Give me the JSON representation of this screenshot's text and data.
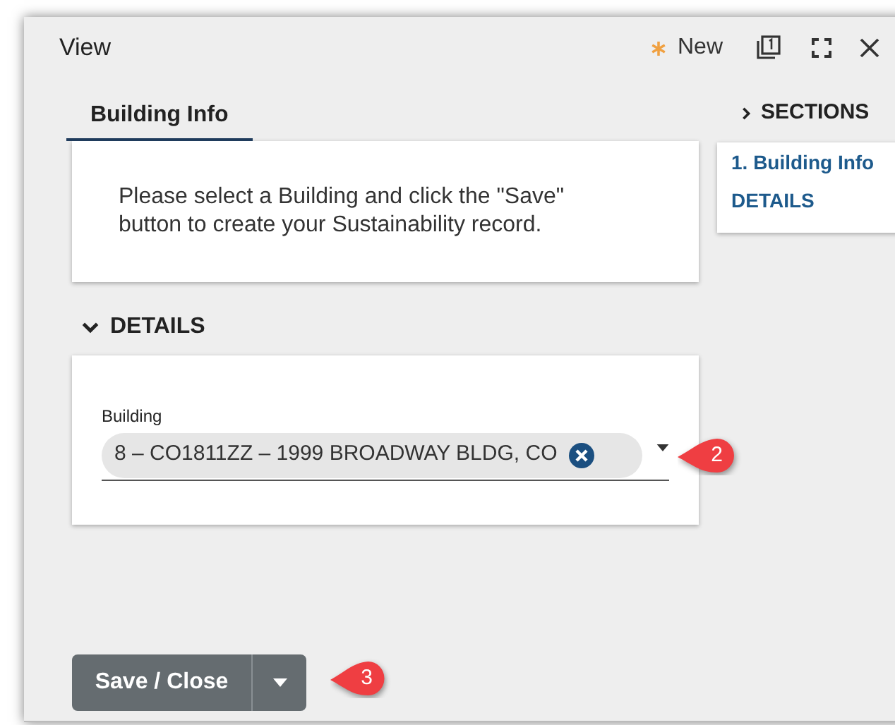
{
  "window": {
    "title": "View",
    "status": "New"
  },
  "tabs": [
    {
      "label": "Building Info",
      "selected": true
    }
  ],
  "message": "Please select a Building and click the \"Save\" button to create your Sustainability record.",
  "sections": {
    "heading": "SECTIONS",
    "expanded": false,
    "items": [
      "1. Building Info",
      "DETAILS"
    ]
  },
  "details": {
    "title": "DETAILS",
    "expanded": true,
    "field": {
      "label": "Building",
      "value": "8 – CO1811ZZ – 1999 BROADWAY BLDG, CO"
    }
  },
  "save_button": "Save / Close",
  "callouts": [
    "2",
    "3"
  ]
}
